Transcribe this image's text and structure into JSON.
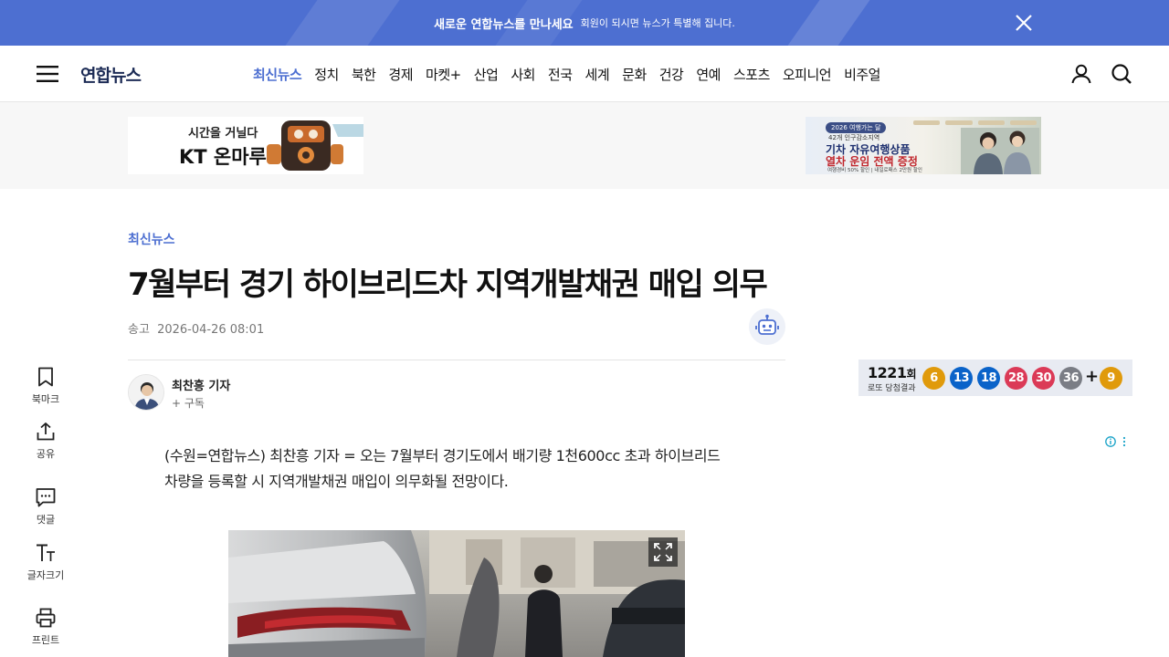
{
  "promo": {
    "main": "새로운 연합뉴스를 만나세요",
    "sub": "회원이 되시면 뉴스가 특별해 집니다."
  },
  "header": {
    "logo": "연합뉴스",
    "nav": [
      {
        "label": "최신뉴스",
        "active": true
      },
      {
        "label": "정치"
      },
      {
        "label": "북한"
      },
      {
        "label": "경제"
      },
      {
        "label": "마켓+"
      },
      {
        "label": "산업"
      },
      {
        "label": "사회"
      },
      {
        "label": "전국"
      },
      {
        "label": "세계"
      },
      {
        "label": "문화"
      },
      {
        "label": "건강"
      },
      {
        "label": "연예"
      },
      {
        "label": "스포츠"
      },
      {
        "label": "오피니언"
      },
      {
        "label": "비주얼"
      }
    ]
  },
  "ads": {
    "left": {
      "line1": "시간을 거닐다",
      "line2": "KT 온마루"
    },
    "right": {
      "pill": "2026 여행가는 달",
      "line1": "42개 인구감소지역",
      "line2": "기차 자유여행상품",
      "line3": "열차 운임 전액 증정",
      "line4": "여행경비 50% 할인 | 내일로패스 2만원 할인"
    }
  },
  "article": {
    "category": "최신뉴스",
    "title": "7월부터 경기 하이브리드차 지역개발채권 매입 의무",
    "sent_label": "송고",
    "sent_time": "2026-04-26 08:01",
    "reporter": "최찬흥 기자",
    "subscribe": "+ 구독",
    "body": [
      "(수원=연합뉴스) 최찬흥 기자 = 오는 7월부터 경기도에서 배기량 1천600cc 초과 하이브리드",
      "차량을 등록할 시 지역개발채권 매입이 의무화될 전망이다."
    ]
  },
  "side_tools": {
    "bookmark": "북마크",
    "share": "공유",
    "comment": "댓글",
    "font_size": "글자크기",
    "print": "프린트"
  },
  "lotto": {
    "round_number": "1221",
    "round_suffix": "회",
    "caption": "로또 당첨결과",
    "numbers": [
      "6",
      "13",
      "18",
      "28",
      "30",
      "36"
    ],
    "plus": "+",
    "bonus": "9",
    "colors": [
      "#e09a0b",
      "#0a63c9",
      "#0a63c9",
      "#db3a57",
      "#db3a57",
      "#7a7d85",
      "#e09a0b"
    ]
  },
  "colors": {
    "brand": "#4d6fd1",
    "logo": "#1c2b55"
  }
}
